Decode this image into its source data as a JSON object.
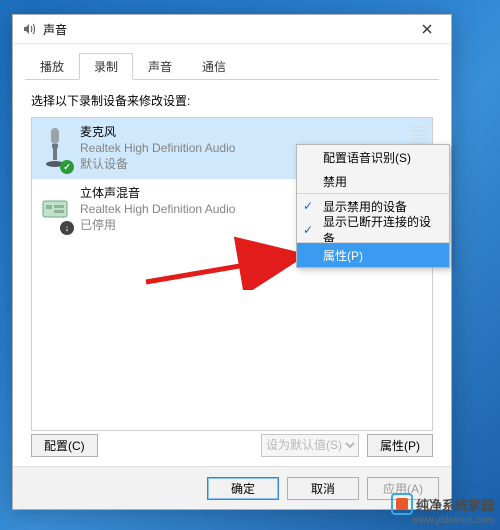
{
  "window": {
    "title": "声音"
  },
  "tabs": {
    "items": [
      "播放",
      "录制",
      "声音",
      "通信"
    ],
    "active_index": 1
  },
  "hint": "选择以下录制设备来修改设置:",
  "devices": [
    {
      "name": "麦克风",
      "driver": "Realtek High Definition Audio",
      "status": "默认设备",
      "selected": true,
      "badge": "ok"
    },
    {
      "name": "立体声混音",
      "driver": "Realtek High Definition Audio",
      "status": "已停用",
      "selected": false,
      "badge": "down"
    }
  ],
  "context_menu": {
    "items": [
      {
        "label": "配置语音识别(S)",
        "checked": false
      },
      {
        "label": "禁用",
        "checked": false
      },
      {
        "label": "显示禁用的设备",
        "checked": true,
        "sep": true
      },
      {
        "label": "显示已断开连接的设备",
        "checked": true
      },
      {
        "label": "属性(P)",
        "checked": false,
        "highlight": true,
        "sep": true
      }
    ]
  },
  "bottom": {
    "configure": "配置(C)",
    "set_default": "设为默认值(S)",
    "properties": "属性(P)"
  },
  "dialog_buttons": {
    "ok": "确定",
    "cancel": "取消",
    "apply": "应用(A)"
  },
  "watermark": {
    "name": "纯净系统家园",
    "url": "www.yidaimei.com"
  }
}
